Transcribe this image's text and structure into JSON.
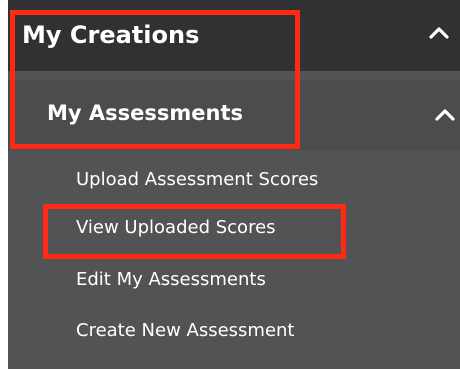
{
  "menu": {
    "section": {
      "title": "My Creations",
      "expand_icon": "chevron-up-icon"
    },
    "subsection": {
      "title": "My Assessments",
      "expand_icon": "chevron-up-icon"
    },
    "items": [
      {
        "label": "Upload Assessment Scores"
      },
      {
        "label": "View Uploaded Scores"
      },
      {
        "label": "Edit My Assessments"
      },
      {
        "label": "Create New Assessment"
      }
    ]
  },
  "colors": {
    "header_bg": "#2f3133",
    "panel_bg": "#525354",
    "highlight": "#ff2a14"
  }
}
